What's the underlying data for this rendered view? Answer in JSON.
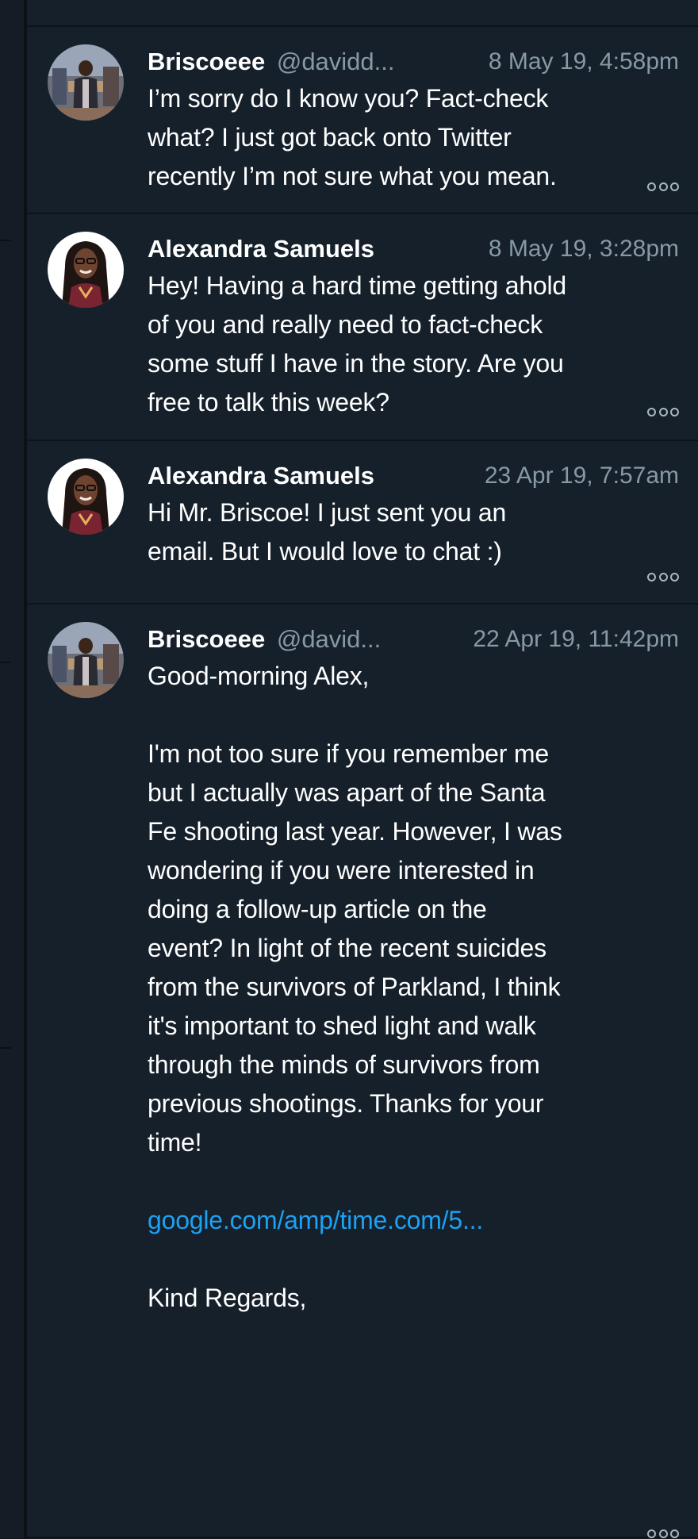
{
  "conversation": {
    "messages": [
      {
        "name": "Briscoeee",
        "handle": "@davidd...",
        "time": "8 May 19, 4:58pm",
        "avatar": "avatar-briscoe",
        "lines": [
          "I’m sorry do I know you? Fact-check",
          "what? I just got back onto Twitter",
          "recently I’m not sure what you mean."
        ],
        "more_label": "More actions"
      },
      {
        "name": "Alexandra Samuels",
        "handle": "",
        "time": "8 May 19, 3:28pm",
        "avatar": "avatar-alexandra",
        "lines": [
          "Hey! Having a hard time getting ahold",
          "of you and really need to fact-check",
          "some stuff I have in the story. Are you",
          "free to talk this week?"
        ],
        "more_label": "More actions"
      },
      {
        "name": "Alexandra Samuels",
        "handle": "",
        "time": "23 Apr 19, 7:57am",
        "avatar": "avatar-alexandra",
        "lines": [
          "Hi Mr. Briscoe! I just sent you an",
          "email. But I would love to chat :)"
        ],
        "more_label": "More actions"
      },
      {
        "name": "Briscoeee",
        "handle": "@david...",
        "time": "22 Apr 19, 11:42pm",
        "avatar": "avatar-briscoe",
        "greeting": "Good-morning Alex,",
        "paragraph": [
          "I'm not too sure if you remember me",
          "but I actually was apart of the Santa",
          "Fe shooting last year. However, I was",
          "wondering if you were interested in",
          "doing a follow-up article on the",
          "event? In light of the recent suicides",
          "from the survivors of Parkland, I think",
          "it's important to shed light and walk",
          "through the minds of survivors from",
          "previous shootings. Thanks for your",
          "time!"
        ],
        "link": "google.com/amp/time.com/5...",
        "closing": "Kind Regards,",
        "more_label": "More actions"
      }
    ]
  },
  "colors": {
    "background": "#15202b",
    "text": "#ffffff",
    "muted": "#8899a6",
    "link": "#1da1f2"
  }
}
